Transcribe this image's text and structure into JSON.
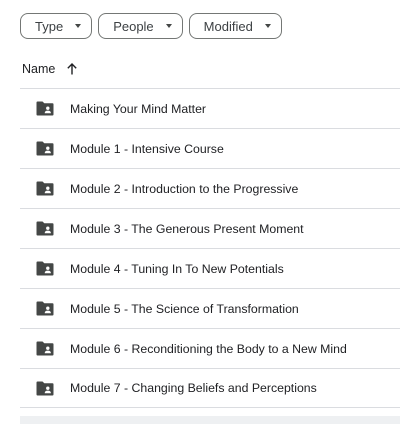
{
  "filters": [
    {
      "label": "Type"
    },
    {
      "label": "People"
    },
    {
      "label": "Modified"
    }
  ],
  "list_header": {
    "name_label": "Name",
    "sort_icon": "arrow-up-icon"
  },
  "items": [
    {
      "name": "Making Your Mind Matter",
      "icon": "shared-folder-icon"
    },
    {
      "name": "Module 1 - Intensive Course",
      "icon": "shared-folder-icon"
    },
    {
      "name": "Module 2 - Introduction to the Progressive",
      "icon": "shared-folder-icon"
    },
    {
      "name": "Module 3 - The Generous Present Moment",
      "icon": "shared-folder-icon"
    },
    {
      "name": "Module 4 - Tuning In To New Potentials",
      "icon": "shared-folder-icon"
    },
    {
      "name": "Module 5 - The Science of Transformation",
      "icon": "shared-folder-icon"
    },
    {
      "name": "Module 6 - Reconditioning the Body to a New Mind",
      "icon": "shared-folder-icon"
    },
    {
      "name": "Module 7 - Changing Beliefs and Perceptions",
      "icon": "shared-folder-icon"
    }
  ],
  "colors": {
    "folder_icon": "#444746",
    "divider": "#dadce0",
    "chip_border": "#747775"
  }
}
